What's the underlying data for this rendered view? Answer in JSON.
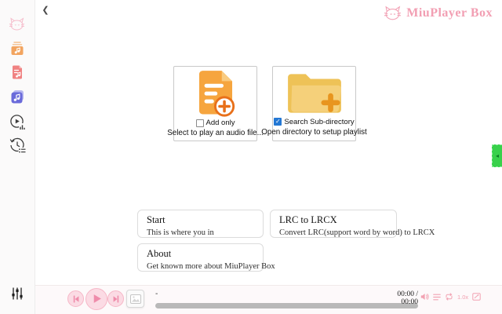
{
  "header": {
    "logo_text": "MiuPlayer Box"
  },
  "icons": {
    "back": "❮",
    "panel_toggle": "◂",
    "checkmark": "✓"
  },
  "sidebar": {
    "items": [
      {
        "name": "app-logo"
      },
      {
        "name": "open-audio-folder"
      },
      {
        "name": "lyrics-file"
      },
      {
        "name": "music-library"
      },
      {
        "name": "now-playing"
      },
      {
        "name": "play-history"
      },
      {
        "name": "equalizer"
      }
    ]
  },
  "main": {
    "open_file_card": {
      "checkbox_label": "Add only",
      "checked": false,
      "caption": "Select to play an audio file..."
    },
    "open_dir_card": {
      "checkbox_label": "Search Sub-directory",
      "checked": true,
      "caption": "Open directory to setup playlist"
    },
    "info_cards": [
      {
        "title": "Start",
        "subtitle": "This is where you in"
      },
      {
        "title": "LRC to LRCX",
        "subtitle": "Convert LRC(support word by word) to LRCX"
      },
      {
        "title": "About",
        "subtitle": "Get known more about MiuPlayer Box"
      }
    ]
  },
  "player": {
    "track_title": "-",
    "time": "00:00 / 00:00",
    "speed": "1.0x",
    "progress_percent": 0
  },
  "colors": {
    "accent_pink": "#f29fb3",
    "button_pink_fill": "#fbdbe4",
    "green_toggle": "#38d14b",
    "checkbox_blue": "#2478d4",
    "doc_orange": "#f6a53e",
    "folder_yellow": "#f5d07a",
    "file_red": "#f08282",
    "library_indigo": "#6a6ada",
    "progress_gray": "#b9b9b9"
  }
}
